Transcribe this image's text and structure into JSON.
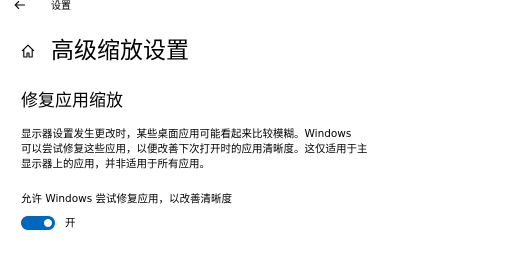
{
  "window": {
    "app_title": "设置"
  },
  "header": {
    "page_title": "高级缩放设置"
  },
  "section": {
    "title": "修复应用缩放",
    "description_lines": [
      "显示器设置发生更改时，某些桌面应用可能看起来比较模糊。Windows",
      "可以尝试修复这些应用，以便改善下次打开时的应用清晰度。这仅适用于主",
      "显示器上的应用，并非适用于所有应用。"
    ],
    "toggle_label": "允许 Windows 尝试修复应用，以改善清晰度",
    "toggle_state": "开",
    "toggle_on": true
  },
  "icons": {
    "back": "back-arrow-icon",
    "home": "home-icon"
  },
  "colors": {
    "accent": "#0067c0",
    "background": "#ffffff",
    "text": "#000000"
  }
}
